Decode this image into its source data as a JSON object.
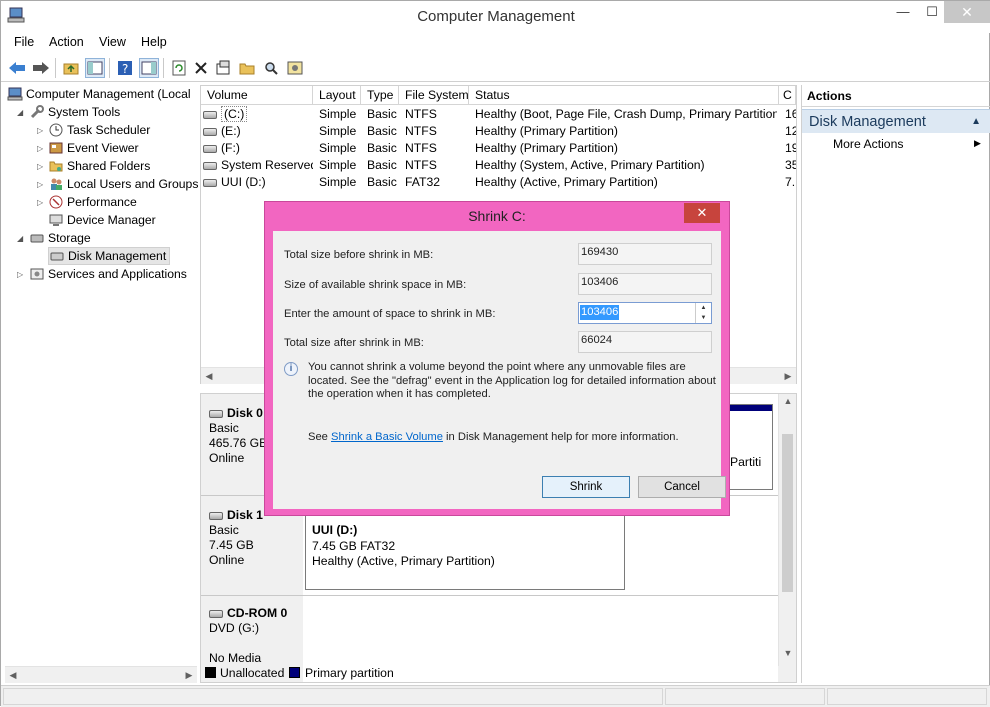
{
  "window": {
    "title": "Computer Management",
    "minimize": "—",
    "maximize": "☐",
    "close": "✕"
  },
  "menu": [
    "File",
    "Action",
    "View",
    "Help"
  ],
  "tree": {
    "root": "Computer Management (Local",
    "system_tools": "System Tools",
    "task_scheduler": "Task Scheduler",
    "event_viewer": "Event Viewer",
    "shared_folders": "Shared Folders",
    "local_users": "Local Users and Groups",
    "performance": "Performance",
    "device_manager": "Device Manager",
    "storage": "Storage",
    "disk_management": "Disk Management",
    "services": "Services and Applications"
  },
  "volumes": {
    "headers": [
      "Volume",
      "Layout",
      "Type",
      "File System",
      "Status",
      "C"
    ],
    "rows": [
      {
        "volume": "(C:)",
        "layout": "Simple",
        "type": "Basic",
        "fs": "NTFS",
        "status": "Healthy (Boot, Page File, Crash Dump, Primary Partition)",
        "cap": "16"
      },
      {
        "volume": "(E:)",
        "layout": "Simple",
        "type": "Basic",
        "fs": "NTFS",
        "status": "Healthy (Primary Partition)",
        "cap": "12"
      },
      {
        "volume": "(F:)",
        "layout": "Simple",
        "type": "Basic",
        "fs": "NTFS",
        "status": "Healthy (Primary Partition)",
        "cap": "19"
      },
      {
        "volume": "System Reserved",
        "layout": "Simple",
        "type": "Basic",
        "fs": "NTFS",
        "status": "Healthy (System, Active, Primary Partition)",
        "cap": "35"
      },
      {
        "volume": "UUI (D:)",
        "layout": "Simple",
        "type": "Basic",
        "fs": "FAT32",
        "status": "Healthy (Active, Primary Partition)",
        "cap": "7."
      }
    ]
  },
  "disks": {
    "disk0": {
      "name": "Disk 0",
      "type": "Basic",
      "size": "465.76 GB",
      "state": "Online",
      "partial_text": "Partiti"
    },
    "disk1": {
      "name": "Disk 1",
      "type": "Basic",
      "size": "7.45 GB",
      "state": "Online",
      "part_name": "UUI  (D:)",
      "part_size": "7.45 GB FAT32",
      "part_status": "Healthy (Active, Primary Partition)"
    },
    "cdrom": {
      "name": "CD-ROM 0",
      "type": "DVD (G:)",
      "state": "No Media"
    }
  },
  "legend": {
    "unallocated": "Unallocated",
    "primary": "Primary partition",
    "unallocated_color": "#000000",
    "primary_color": "#00007a"
  },
  "actions": {
    "header": "Actions",
    "section": "Disk Management",
    "more": "More Actions"
  },
  "dialog": {
    "title": "Shrink C:",
    "close": "✕",
    "total_before_label": "Total size before shrink in MB:",
    "total_before": "169430",
    "available_label": "Size of available shrink space in MB:",
    "available": "103406",
    "amount_label": "Enter the amount of space to shrink in MB:",
    "amount": "103406",
    "total_after_label": "Total size after shrink in MB:",
    "total_after": "66024",
    "note": "You cannot shrink a volume beyond the point where any unmovable files are located. See the \"defrag\" event in the Application log for detailed information about the operation when it has completed.",
    "help_pre": "See ",
    "help_link": "Shrink a Basic Volume",
    "help_post": " in Disk Management help for more information.",
    "shrink": "Shrink",
    "cancel": "Cancel"
  }
}
